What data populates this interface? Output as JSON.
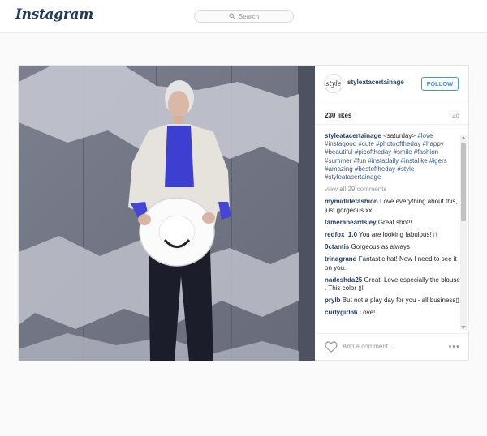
{
  "header": {
    "logo": "Instagram",
    "search_placeholder": "Search"
  },
  "post": {
    "avatar_text": "style",
    "username": "styleatacertainage",
    "follow_label": "FOLLOW",
    "likes": "230 likes",
    "age": "2d",
    "caption_user": "styleatacertainage",
    "caption_plain": "<saturday>",
    "caption_tags": "#love #instagood #cute #photooftheday #happy #beautiful #picoftheday #smile #fashion #summer #fun #instadaily #instalike #igers #amazing #bestoftheday #style #styleatacertainage",
    "view_all": "view all 29 comments",
    "comments": [
      {
        "user": "mymidlifefashion",
        "text": "Love everything about this, just gorgeous xx"
      },
      {
        "user": "tamerabeardsley",
        "text": "Great shot!!"
      },
      {
        "user": "redfox_1.0",
        "text": "You are looking fabulous! ▯"
      },
      {
        "user": "0ctantis",
        "text": "Gorgeous as always"
      },
      {
        "user": "trinagrand",
        "text": "Fantastic hat! Now I need to see it on you."
      },
      {
        "user": "nadeshda25",
        "text": "Great! Love especially the blouse . This color ▯!"
      },
      {
        "user": "prylb",
        "text": "But not a play day for you - all business▯"
      },
      {
        "user": "curlygirl66",
        "text": "Love!"
      }
    ],
    "add_comment_placeholder": "Add a comment...",
    "more_label": "•••"
  },
  "colors": {
    "link": "#1e3a5c",
    "accent": "#3897f0",
    "muted": "#999999"
  }
}
